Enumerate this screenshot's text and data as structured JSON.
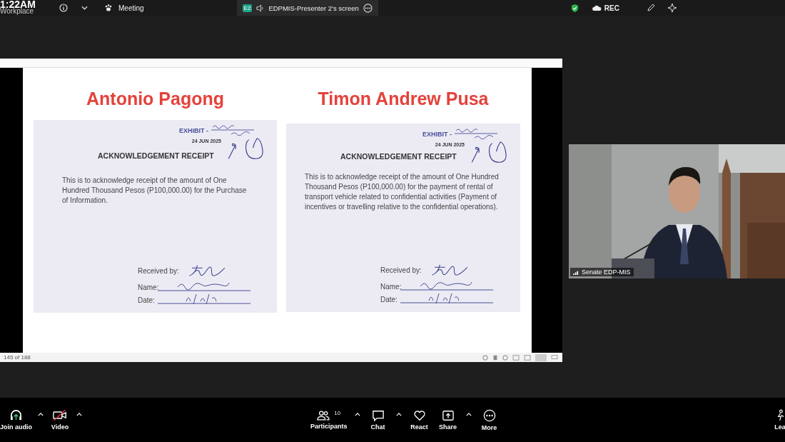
{
  "top_bar": {
    "time": "1:22AM",
    "workspace": "Workplace",
    "meeting": "Meeting",
    "share_tab": {
      "badge": "E2",
      "title": "EDPMIS-Presenter 2's screen"
    },
    "rec": "REC"
  },
  "slide": {
    "people": [
      {
        "name": "Antonio Pagong",
        "exhibit": "EXHIBIT -",
        "stamp": "24 JUN 2025",
        "heading": "ACKNOWLEDGEMENT RECEIPT",
        "body": "This is to acknowledge receipt of the amount of One Hundred Thousand Pesos (P100,000.00) for the Purchase of Information.",
        "received": "Received by:",
        "name_label": "Name:",
        "date_label": "Date:"
      },
      {
        "name": "Timon Andrew Pusa",
        "exhibit": "EXHIBIT -",
        "stamp": "24 JUN 2025",
        "heading": "ACKNOWLEDGEMENT RECEIPT",
        "body": "This is to acknowledge receipt of the amount of One Hundred Thousand Pesos (P100,000.00) for the payment of rental of transport vehicle related to confidential activities (Payment of incentives or travelling relative to the confidential operations).",
        "received": "Received by:",
        "name_label": "Name:",
        "date_label": "Date:"
      }
    ],
    "status": "145 of 188"
  },
  "video": {
    "label": "Senate EDP-MIS"
  },
  "toolbar": [
    {
      "kind": "audio",
      "label": "Join audio",
      "chevron": true
    },
    {
      "kind": "video",
      "label": "Video",
      "chevron": true,
      "on": false
    },
    {
      "kind": "participants",
      "label": "Participants",
      "count": "10",
      "chevron": true
    },
    {
      "kind": "chat",
      "label": "Chat",
      "chevron": true
    },
    {
      "kind": "react",
      "label": "React",
      "chevron": false
    },
    {
      "kind": "share",
      "label": "Share",
      "chevron": true
    },
    {
      "kind": "more",
      "label": "More",
      "chevron": false
    },
    {
      "kind": "leave",
      "label": "Lea",
      "chevron": false
    }
  ]
}
